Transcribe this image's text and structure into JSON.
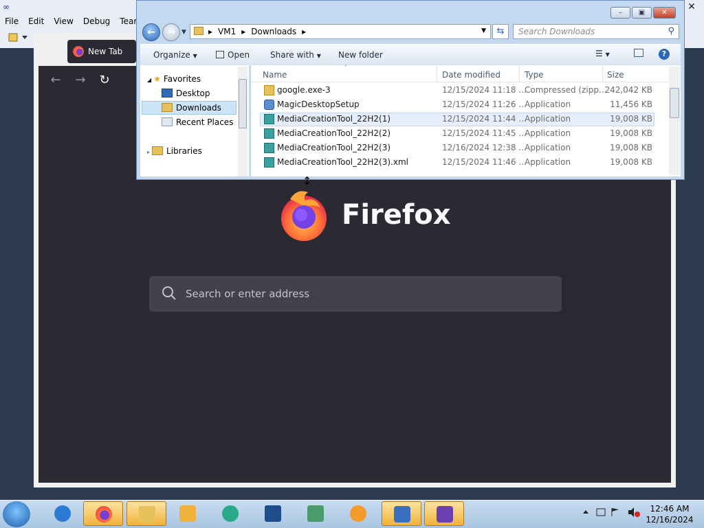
{
  "host_app": {
    "menu": [
      "File",
      "Edit",
      "View",
      "Debug",
      "Team"
    ]
  },
  "firefox": {
    "tab_title": "New Tab",
    "logo_text": "Firefox",
    "search_placeholder": "Search or enter address"
  },
  "explorer": {
    "breadcrumb": [
      "VM1",
      "Downloads"
    ],
    "search_placeholder": "Search Downloads",
    "commands": [
      "Organize",
      "Open",
      "Share with",
      "New folder"
    ],
    "nav": {
      "favorites": "Favorites",
      "desktop": "Desktop",
      "downloads": "Downloads",
      "recent_places": "Recent Places",
      "libraries": "Libraries"
    },
    "columns": [
      "Name",
      "Date modified",
      "Type",
      "Size"
    ],
    "files": [
      {
        "name": "google.exe-3",
        "date": "12/15/2024 11:18 ...",
        "type": "Compressed (zipp...",
        "size": "242,042 KB"
      },
      {
        "name": "MagicDesktopSetup",
        "date": "12/15/2024 11:26 ...",
        "type": "Application",
        "size": "11,456 KB"
      },
      {
        "name": "MediaCreationTool_22H2(1)",
        "date": "12/15/2024 11:44 ...",
        "type": "Application",
        "size": "19,008 KB"
      },
      {
        "name": "MediaCreationTool_22H2(2)",
        "date": "12/15/2024 11:45 ...",
        "type": "Application",
        "size": "19,008 KB"
      },
      {
        "name": "MediaCreationTool_22H2(3)",
        "date": "12/16/2024 12:38 ...",
        "type": "Application",
        "size": "19,008 KB"
      },
      {
        "name": "MediaCreationTool_22H2(3).xml",
        "date": "12/15/2024 11:46 ...",
        "type": "Application",
        "size": "19,008 KB"
      }
    ]
  },
  "taskbar": {
    "time": "12:46 AM",
    "date": "12/16/2024"
  }
}
